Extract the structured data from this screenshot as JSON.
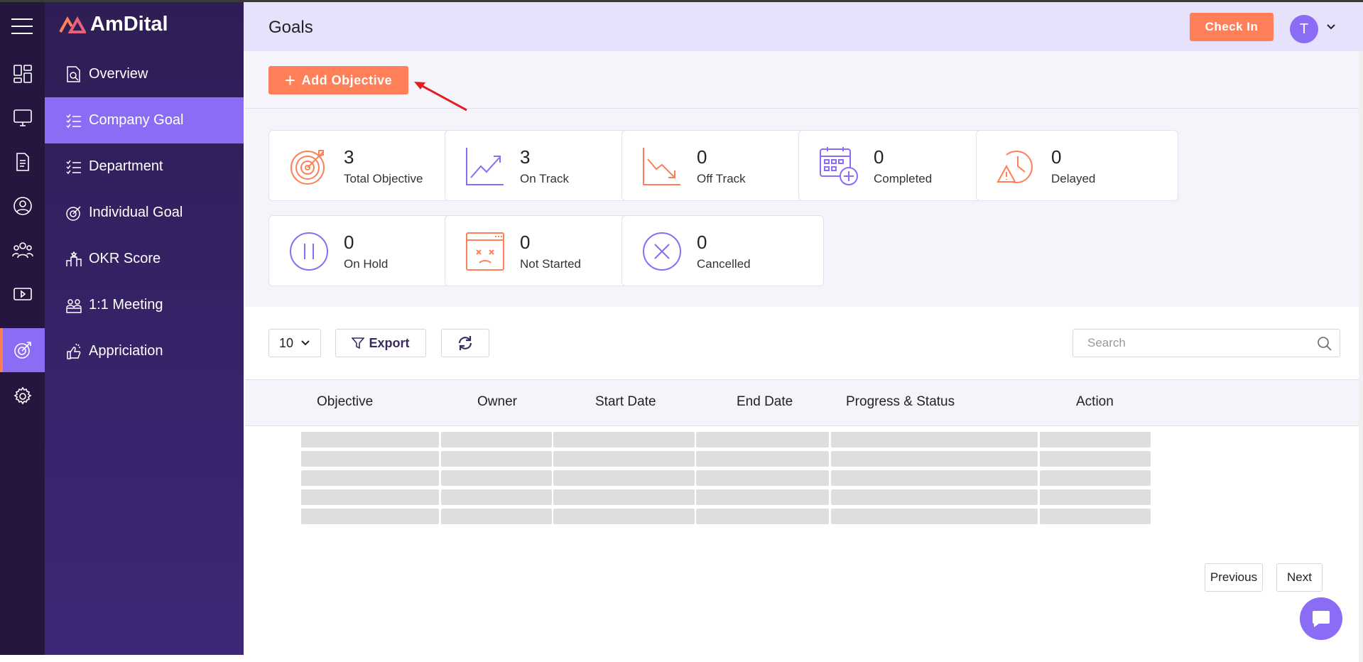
{
  "app": {
    "name": "AmDital"
  },
  "header": {
    "title": "Goals",
    "check_in_label": "Check In",
    "avatar_initial": "T"
  },
  "sidebar": {
    "items": [
      {
        "label": "Overview",
        "icon": "document-search-icon"
      },
      {
        "label": "Company Goal",
        "icon": "list-check-icon",
        "active": true
      },
      {
        "label": "Department",
        "icon": "list-check-icon"
      },
      {
        "label": "Individual Goal",
        "icon": "target-icon"
      },
      {
        "label": "OKR Score",
        "icon": "podium-icon"
      },
      {
        "label": "1:1 Meeting",
        "icon": "meeting-icon"
      },
      {
        "label": "Appriciation",
        "icon": "appreciation-icon"
      }
    ]
  },
  "rail": {
    "icons": [
      "dashboard-icon",
      "monitor-icon",
      "document-icon",
      "user-circle-icon",
      "team-icon",
      "video-icon",
      "goal-icon",
      "settings-icon"
    ],
    "active_index": 6
  },
  "toolbar": {
    "add_objective_label": "Add Objective"
  },
  "stats": [
    {
      "value": "3",
      "label": "Total Objective",
      "icon": "target-icon"
    },
    {
      "value": "3",
      "label": "On Track",
      "icon": "trend-up-icon"
    },
    {
      "value": "0",
      "label": "Off Track",
      "icon": "trend-down-icon"
    },
    {
      "value": "0",
      "label": "Completed",
      "icon": "calendar-add-icon"
    },
    {
      "value": "0",
      "label": "Delayed",
      "icon": "clock-alert-icon"
    },
    {
      "value": "0",
      "label": "On Hold",
      "icon": "pause-icon"
    },
    {
      "value": "0",
      "label": "Not Started",
      "icon": "browser-sad-icon"
    },
    {
      "value": "0",
      "label": "Cancelled",
      "icon": "cancel-icon"
    }
  ],
  "table": {
    "page_size": "10",
    "export_label": "Export",
    "search_placeholder": "Search",
    "columns": [
      "Objective",
      "Owner",
      "Start Date",
      "End Date",
      "Progress & Status",
      "Action"
    ],
    "loading_rows": 5
  },
  "pagination": {
    "previous_label": "Previous",
    "next_label": "Next"
  },
  "colors": {
    "accent": "#8a6cf5",
    "orange": "#ff8058",
    "sidebar": "#2f1d55",
    "rail": "#25163f"
  }
}
